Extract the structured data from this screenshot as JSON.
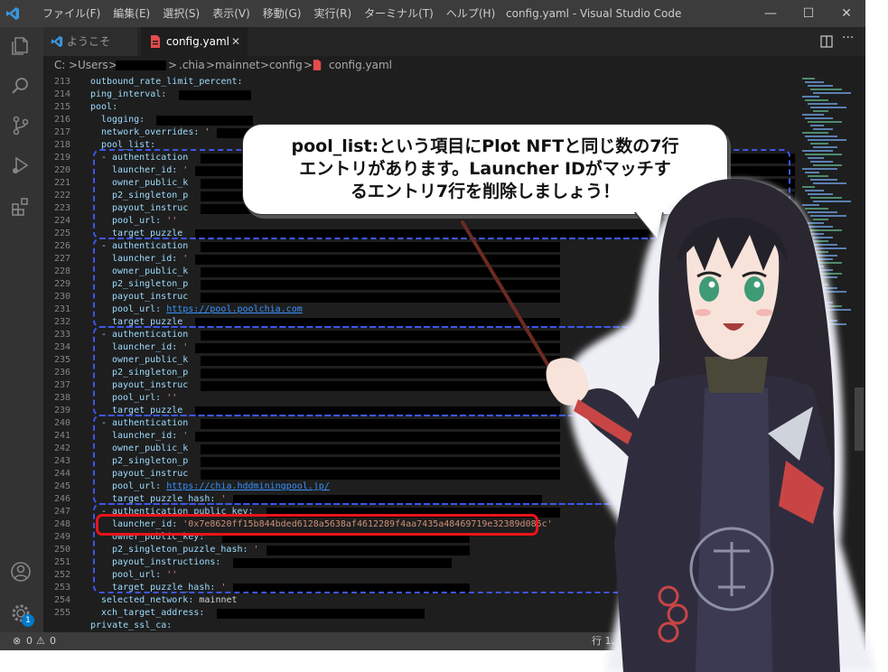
{
  "window": {
    "title": "config.yaml - Visual Studio Code",
    "menu": [
      "ファイル(F)",
      "編集(E)",
      "選択(S)",
      "表示(V)",
      "移動(G)",
      "実行(R)",
      "ターミナル(T)",
      "ヘルプ(H)"
    ],
    "controls": {
      "minimize": "—",
      "maximize": "☐",
      "close": "✕"
    }
  },
  "tabs": [
    {
      "label": "ようこそ",
      "icon": "vscode-logo-icon"
    },
    {
      "label": "config.yaml",
      "icon": "yaml-file-icon",
      "close": "✕"
    }
  ],
  "breadcrumb": {
    "items": [
      "C:",
      "Users",
      ".chia",
      "mainnet",
      "config",
      "config.yaml"
    ],
    "separator": ">"
  },
  "editor": {
    "line_numbers": [
      "213",
      "214",
      "215",
      "216",
      "217",
      "218",
      "219",
      "220",
      "221",
      "222",
      "223",
      "224",
      "225",
      "226",
      "227",
      "228",
      "229",
      "230",
      "231",
      "232",
      "233",
      "234",
      "235",
      "236",
      "237",
      "238",
      "239",
      "240",
      "241",
      "242",
      "243",
      "244",
      "245",
      "246",
      "247",
      "248",
      "249",
      "250",
      "251",
      "252",
      "253",
      "254",
      "255"
    ],
    "lines": [
      {
        "key": "outbound_rate_limit_percent:",
        "val": ""
      },
      {
        "key": "ping_interval:",
        "val": ""
      },
      {
        "key": "pool:",
        "val": ""
      },
      {
        "key": "logging:",
        "val": ""
      },
      {
        "key": "network_overrides:",
        "val": "'"
      },
      {
        "key": "pool_list:",
        "val": ""
      },
      {
        "key": "- authentication",
        "val": ""
      },
      {
        "key": "launcher_id:",
        "val": "'"
      },
      {
        "key": "owner_public_k",
        "val": ""
      },
      {
        "key": "p2_singleton_p",
        "val": ""
      },
      {
        "key": "payout_instruc",
        "val": ""
      },
      {
        "key": "pool_url:",
        "val": "''"
      },
      {
        "key": "target_puzzle",
        "val": ""
      },
      {
        "key": "- authentication",
        "val": ""
      },
      {
        "key": "launcher_id:",
        "val": "'"
      },
      {
        "key": "owner_public_k",
        "val": ""
      },
      {
        "key": "p2_singleton_p",
        "val": ""
      },
      {
        "key": "payout_instruc",
        "val": ""
      },
      {
        "key": "pool_url:",
        "url": "https://pool.poolchia.com"
      },
      {
        "key": "target_puzzle",
        "val": ""
      },
      {
        "key": "- authentication",
        "val": ""
      },
      {
        "key": "launcher_id:",
        "val": "'"
      },
      {
        "key": "owner_public_k",
        "val": ""
      },
      {
        "key": "p2_singleton_p",
        "val": ""
      },
      {
        "key": "payout_instruc",
        "val": ""
      },
      {
        "key": "pool_url:",
        "val": "''"
      },
      {
        "key": "target_puzzle",
        "val": ""
      },
      {
        "key": "- authentication",
        "val": ""
      },
      {
        "key": "launcher_id:",
        "val": "'"
      },
      {
        "key": "owner_public_k",
        "val": ""
      },
      {
        "key": "p2_singleton_p",
        "val": ""
      },
      {
        "key": "payout_instruc",
        "val": ""
      },
      {
        "key": "pool_url:",
        "url": "https://chia.hddminingpool.jp/"
      },
      {
        "key": "target_puzzle_hash:",
        "val": "'"
      },
      {
        "key": "- authentication_public_key:",
        "val": ""
      },
      {
        "key": "launcher_id:",
        "val": "'0x7e8620ff15b844bded6128a5638af4612289f4aa7435a48469719e32389d085c'"
      },
      {
        "key": "owner_public_key:",
        "val": "'"
      },
      {
        "key": "p2_singleton_puzzle_hash:",
        "val": "'"
      },
      {
        "key": "payout_instructions:",
        "val": ""
      },
      {
        "key": "pool_url:",
        "val": "''"
      },
      {
        "key": "target_puzzle_hash:",
        "val": "'"
      },
      {
        "key": "selected_network:",
        "val": "mainnet"
      },
      {
        "key": "xch_target_address:",
        "val": ""
      },
      {
        "key": "private_ssl_ca:",
        "val": ""
      }
    ]
  },
  "callout": {
    "line1": "pool_list:という項目にPlot NFTと同じ数の7行",
    "line2": "エントリがあります。Launcher IDがマッチす",
    "line3": "るエントリ7行を削除しましょう！"
  },
  "statusbar": {
    "errors": "0",
    "warnings": "0",
    "position": "行 1、列",
    "notification_badge": "1"
  },
  "colors": {
    "highlight_dash": "#3d56e8",
    "highlight_box": "#e8141a",
    "accent": "#007acc"
  }
}
